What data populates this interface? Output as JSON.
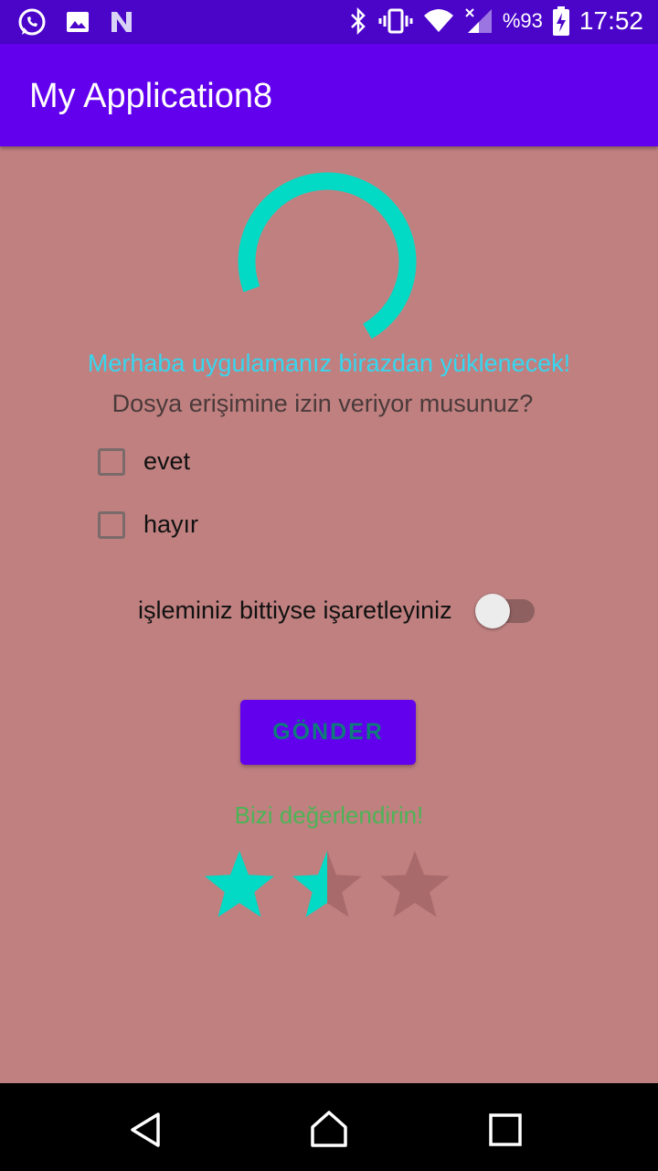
{
  "status_bar": {
    "battery_text": "%93",
    "time": "17:52",
    "left_icons": [
      "whatsapp-icon",
      "image-icon",
      "n-app-icon"
    ],
    "right_icons": [
      "bluetooth-icon",
      "vibrate-icon",
      "wifi-icon",
      "signal-icon",
      "battery-charging-icon"
    ]
  },
  "app_bar": {
    "title": "My Application8"
  },
  "content": {
    "loading_message": "Merhaba uygulamanız birazdan yüklenecek!",
    "permission_question": "Dosya erişimine izin veriyor musunuz?",
    "checkboxes": [
      {
        "label": "evet",
        "checked": false
      },
      {
        "label": "hayır",
        "checked": false
      }
    ],
    "switch": {
      "label": "işleminiz bittiyse işaretleyiniz",
      "on": false
    },
    "submit_button": "GÖNDER",
    "rating_prompt": "Bizi değerlendirin!",
    "rating": {
      "value": 1.5,
      "max": 3
    }
  },
  "colors": {
    "status_bar": "#4a05c9",
    "app_bar": "#6200ee",
    "background": "#c08080",
    "accent": "#03dac5",
    "loading_text": "#35d7f0",
    "question_text": "#4a3a3a",
    "button_bg": "#6200ee",
    "button_text": "#0e7c79",
    "rating_text": "#4db356",
    "star_empty": "#a86a6a"
  },
  "nav_bar": {
    "icons": [
      "back-icon",
      "home-icon",
      "recents-icon"
    ]
  }
}
